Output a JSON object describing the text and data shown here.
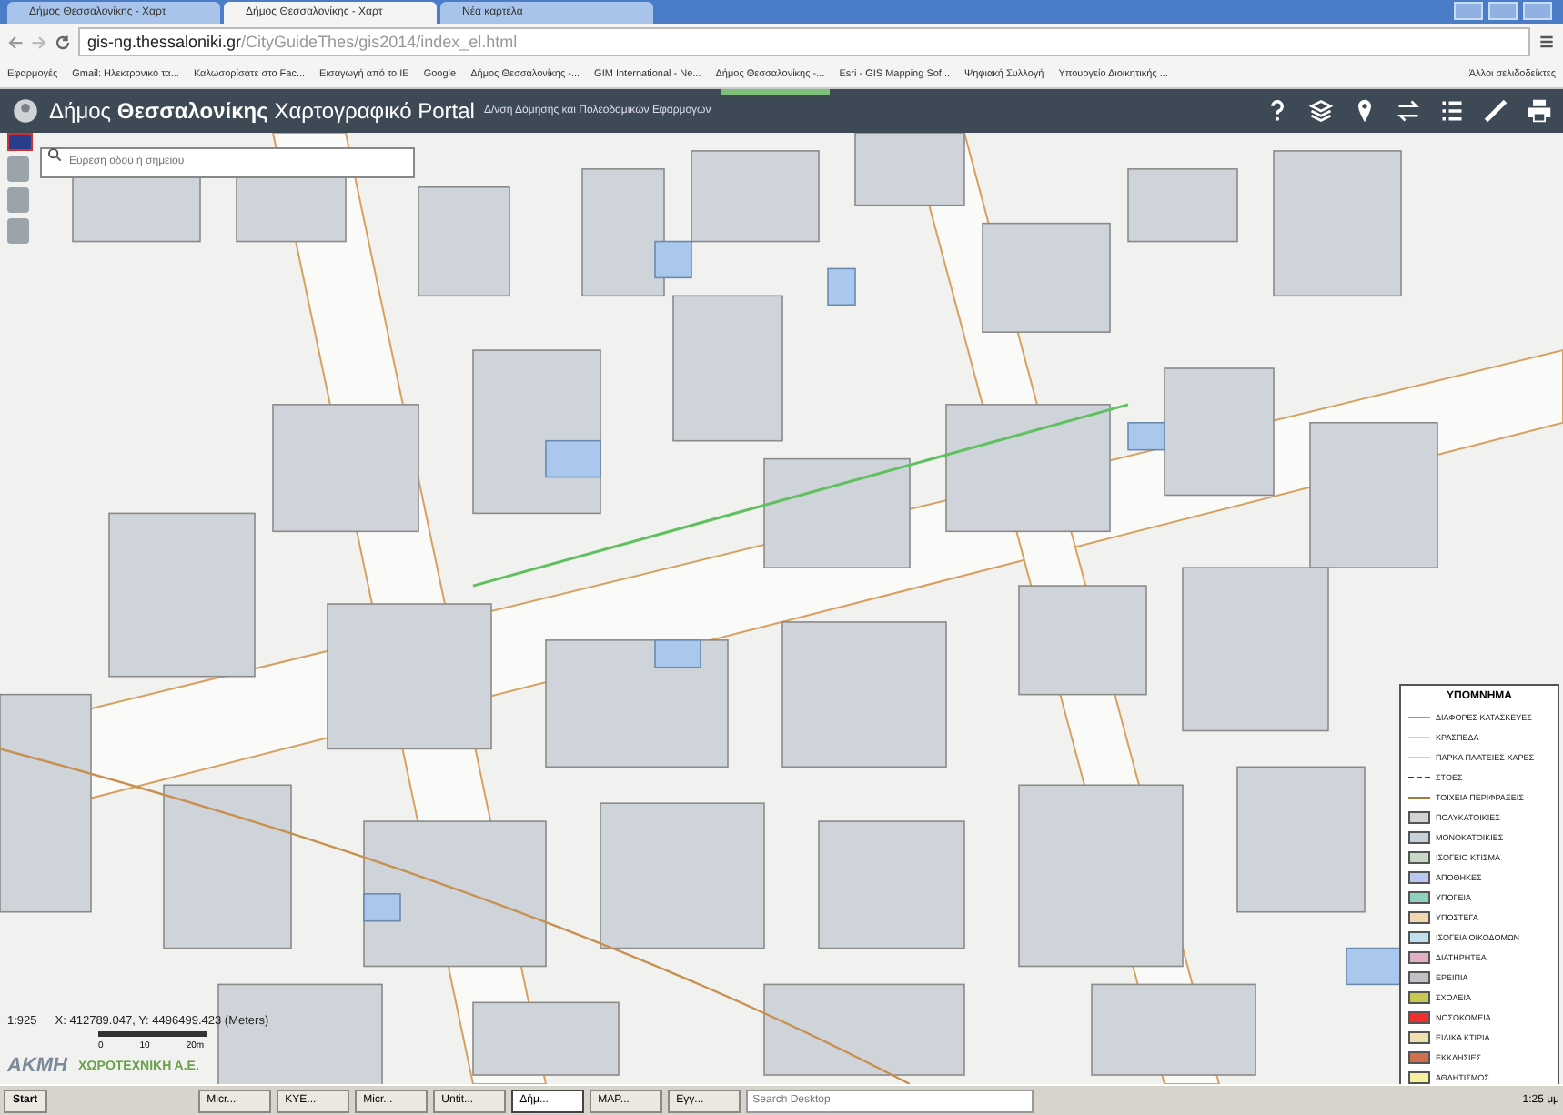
{
  "browser": {
    "tabs": [
      {
        "label": "Δήμος Θεσσαλονίκης - Χαρτ",
        "selected": false
      },
      {
        "label": "Δήμος Θεσσαλονίκης - Χαρτ",
        "selected": true
      },
      {
        "label": "Νέα καρτέλα",
        "selected": false
      }
    ],
    "url_host": "gis-ng.thessaloniki.gr",
    "url_path": "/CityGuideThes/gis2014/index_el.html",
    "bookmarks": [
      "Εφαρμογές",
      "Gmail: Ηλεκτρονικό τα...",
      "Καλωσορίσατε στο Fac...",
      "Εισαγωγή από το IE",
      "Google",
      "Δήμος Θεσσαλονίκης -...",
      "GIM International - Ne...",
      "Δήμος Θεσσαλονίκης -...",
      "Esri - GIS Mapping Sof...",
      "Ψηφιακή Συλλογή",
      "Υπουργείο Διοικητικής ..."
    ],
    "other_bookmarks": "Άλλοι σελιδοδείκτες"
  },
  "app": {
    "title": "Δήμος **Θεσσαλονίκης** Χαρτογραφικό Portal",
    "subtitle": "Δ/νση Δόμησης και Πολεοδομικών Εφαρμογών",
    "search": {
      "placeholder": "Εύρεση οδού ή σημείου"
    },
    "scale": "1:925",
    "coordinates": "X: 412789.047, Y: 4496499.423 (Meters)",
    "scale_bar_labels": [
      "0",
      "10",
      "20m"
    ],
    "logos": [
      "ΑΚΜΗ",
      "ΧΩΡΟΤΕΧΝΙΚΗ Α.Ε."
    ]
  },
  "legend": {
    "title": "ΥΠΟΜΝΗΜΑ",
    "items": [
      {
        "kind": "line",
        "label": "ΔΙΑΦΟΡΕΣ ΚΑΤΑΣΚΕΥΕΣ",
        "color": "#9a9a9a"
      },
      {
        "kind": "line",
        "label": "ΚΡΑΣΠΕΔΑ",
        "color": "#d0d0d0"
      },
      {
        "kind": "line",
        "label": "ΠΑΡΚΑ ΠΛΑΤΕΙΕΣ ΧΑΡΕΣ",
        "color": "#b8e0a0"
      },
      {
        "kind": "dashed",
        "label": "ΣΤΟΕΣ",
        "color": "#333333"
      },
      {
        "kind": "line",
        "label": "ΤΟΙΧΕΙΑ ΠΕΡΙΦΡΑΞΕΙΣ",
        "color": "#a08040"
      },
      {
        "kind": "swatch",
        "label": "ΠΟΛΥΚΑΤΟΙΚΙΕΣ",
        "color": "#d3d3d3"
      },
      {
        "kind": "swatch",
        "label": "ΜΟΝΟΚΑΤΟΙΚΙΕΣ",
        "color": "#c8d0da"
      },
      {
        "kind": "swatch",
        "label": "ΙΣΟΓΕΙΟ ΚΤΙΣΜΑ",
        "color": "#c8d8c8"
      },
      {
        "kind": "swatch",
        "label": "ΑΠΟΘΗΚΕΣ",
        "color": "#b8c8f0"
      },
      {
        "kind": "swatch",
        "label": "ΥΠΟΓΕΙΑ",
        "color": "#90d0c0"
      },
      {
        "kind": "swatch",
        "label": "ΥΠΟΣΤΕΓΑ",
        "color": "#f0d8b0"
      },
      {
        "kind": "swatch",
        "label": "ΙΣΟΓΕΙΑ ΟΙΚΟΔΟΜΩΝ",
        "color": "#c0e0f0"
      },
      {
        "kind": "swatch",
        "label": "ΔΙΑΤΗΡΗΤΕΑ",
        "color": "#e0b0c8"
      },
      {
        "kind": "swatch",
        "label": "ΕΡΕΙΠΙΑ",
        "color": "#c0c0c8"
      },
      {
        "kind": "swatch",
        "label": "ΣΧΟΛΕΙΑ",
        "color": "#c8c850"
      },
      {
        "kind": "swatch",
        "label": "ΝΟΣΟΚΟΜΕΙΑ",
        "color": "#f03030"
      },
      {
        "kind": "swatch",
        "label": "ΕΙΔΙΚΑ ΚΤΙΡΙΑ",
        "color": "#f0e0b0"
      },
      {
        "kind": "swatch",
        "label": "ΕΚΚΛΗΣΙΕΣ",
        "color": "#d07050"
      },
      {
        "kind": "swatch",
        "label": "ΑΘΛΗΤΙΣΜΟΣ",
        "color": "#f8f0a0"
      }
    ]
  },
  "taskbar": {
    "start": "Start",
    "tasks": [
      {
        "label": "Micr...",
        "selected": false
      },
      {
        "label": "ΚΥΕ...",
        "selected": false
      },
      {
        "label": "Micr...",
        "selected": false
      },
      {
        "label": "Untit...",
        "selected": false
      },
      {
        "label": "Δήμ...",
        "selected": true
      },
      {
        "label": "ΜΑΡ...",
        "selected": false
      },
      {
        "label": "Εγγ...",
        "selected": false
      }
    ],
    "search_placeholder": "Search Desktop",
    "clock": "1:25 μμ"
  }
}
